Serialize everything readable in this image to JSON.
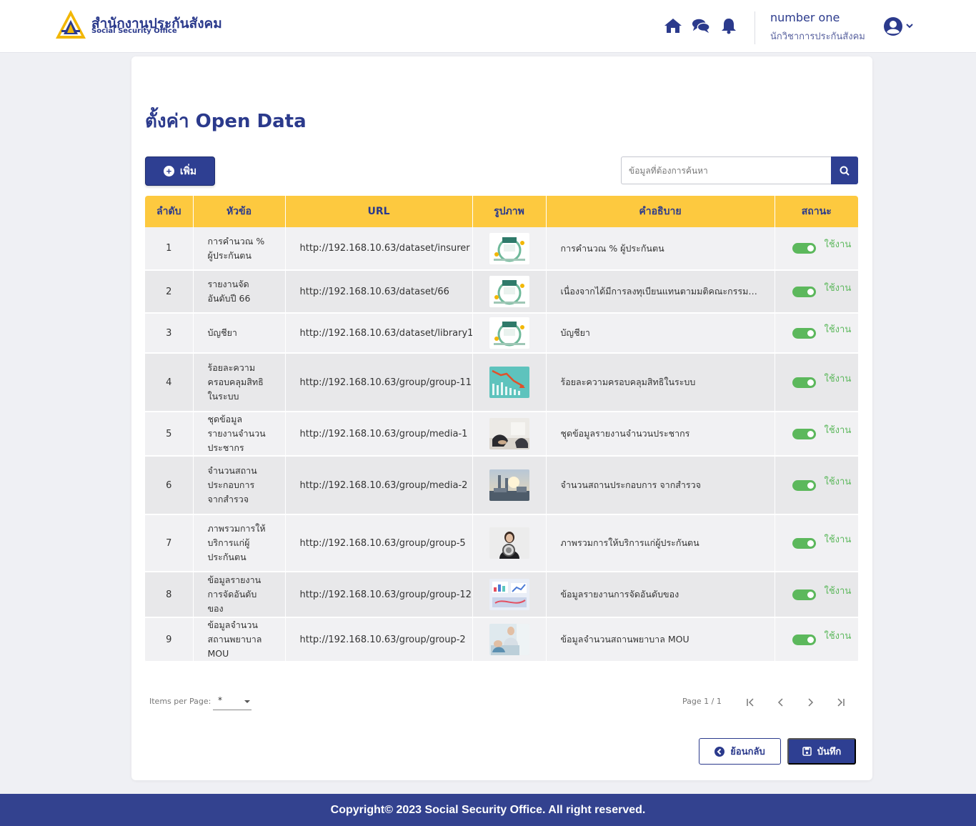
{
  "header": {
    "brand_th": "สำนักงานประกันสังคม",
    "brand_en": "Social Security Office",
    "user_name": "number one",
    "user_role": "นักวิชาการประกันสังคม",
    "icons": [
      "home-icon",
      "chat-icon",
      "bell-icon",
      "user-circle-icon",
      "chevron-down-icon"
    ]
  },
  "page": {
    "title": "ตั้งค่า Open Data",
    "add_label": "เพิ่ม",
    "search_placeholder": "ข้อมูลที่ต้องการค้นหา"
  },
  "table": {
    "headers": [
      "ลำดับ",
      "หัวข้อ",
      "URL",
      "รูปภาพ",
      "คำอธิบาย",
      "สถานะ"
    ],
    "rows": [
      {
        "no": "1",
        "title": "การคำนวณ % ผู้ประกันตน",
        "url": "http://192.168.10.63/dataset/insurer",
        "image": "open-data-icon",
        "desc": "การคำนวณ % ผู้ประกันตน",
        "status": "ใช้งาน"
      },
      {
        "no": "2",
        "title": "รายงานจัดอันดับปี 66",
        "url": "http://192.168.10.63/dataset/66",
        "image": "open-data-icon",
        "desc": "เนื่องจากได้มีการลงทุเบียนแทนตามมติคณะกรรมการหลักประกันสุขภาพ",
        "status": "ใช้งาน"
      },
      {
        "no": "3",
        "title": "บัญชียา",
        "url": "http://192.168.10.63/dataset/library1",
        "image": "open-data-icon",
        "desc": "บัญชียา",
        "status": "ใช้งาน"
      },
      {
        "no": "4",
        "title": "ร้อยละความครอบคลุมสิทธิในระบบ",
        "url": "http://192.168.10.63/group/group-11",
        "image": "chart-down-image",
        "desc": "ร้อยละความครอบคลุมสิทธิในระบบ",
        "status": "ใช้งาน"
      },
      {
        "no": "5",
        "title": "ชุดข้อมูลรายงานจำนวนประชากร",
        "url": "http://192.168.10.63/group/media-1",
        "image": "meeting-photo",
        "desc": "ชุดข้อมูลรายงานจำนวนประชากร",
        "status": "ใช้งาน"
      },
      {
        "no": "6",
        "title": "จำนวนสถานประกอบการ จากสำรวจ",
        "url": "http://192.168.10.63/group/media-2",
        "image": "factory-photo",
        "desc": "จำนวนสถานประกอบการ จากสำรวจ",
        "status": "ใช้งาน"
      },
      {
        "no": "7",
        "title": "ภาพรวมการให้บริการแก่ผู้ประกันตน",
        "url": "http://192.168.10.63/group/group-5",
        "image": "megaphone-photo",
        "desc": "ภาพรวมการให้บริการแก่ผู้ประกันตน",
        "status": "ใช้งาน"
      },
      {
        "no": "8",
        "title": "ข้อมูลรายงานการจัดอันดับของ",
        "url": "http://192.168.10.63/group/group-12",
        "image": "report-photo",
        "desc": "ข้อมูลรายงานการจัดอันดับของ",
        "status": "ใช้งาน"
      },
      {
        "no": "9",
        "title": "ข้อมูลจำนวนสถานพยาบาล MOU",
        "url": "http://192.168.10.63/group/group-2",
        "image": "hospital-photo",
        "desc": "ข้อมูลจำนวนสถานพยาบาล MOU",
        "status": "ใช้งาน"
      }
    ]
  },
  "pagination": {
    "items_per_page_label": "Items per Page:",
    "items_per_page_value": "*",
    "page_info": "Page 1 / 1"
  },
  "actions": {
    "back_label": "ย้อนกลับ",
    "save_label": "บันทึก"
  },
  "footer": {
    "copyright": "Copyright© 2023 Social Security Office. All right reserved."
  },
  "colors": {
    "primary": "#2e3f92",
    "header_yellow": "#fdc93f",
    "status_green": "#5cb85c"
  }
}
